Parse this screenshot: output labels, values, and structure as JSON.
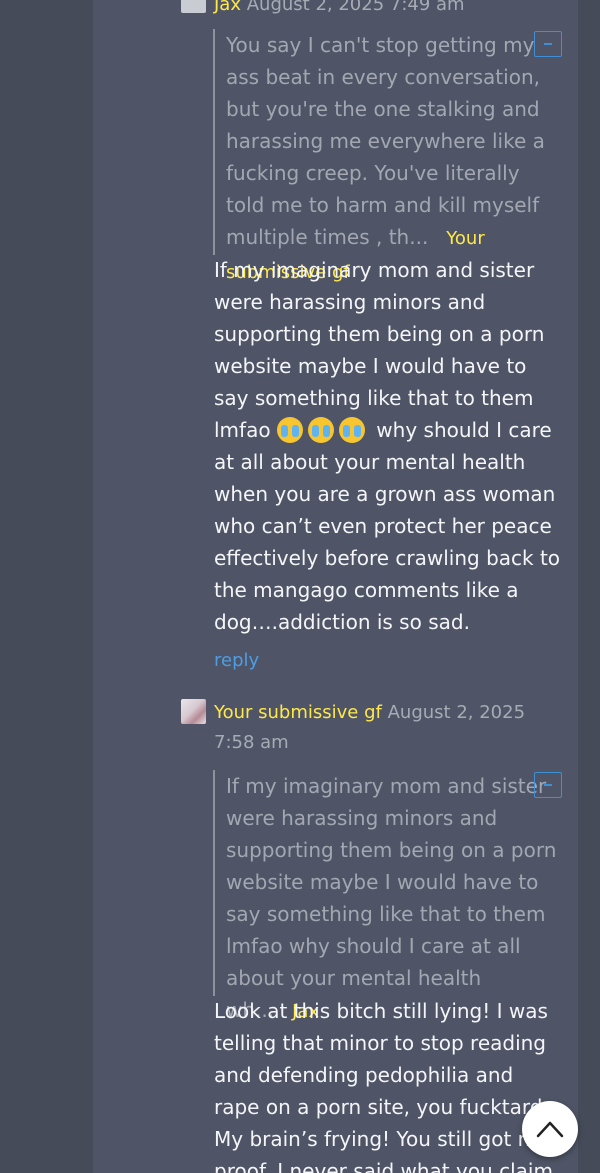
{
  "comments": [
    {
      "author": "Jax",
      "timestamp": "August 2, 2025 7:49 am",
      "quote_text": "You say I can't stop getting my ass beat in every conversation, but you're the one stalking and harassing me everywhere like a fucking creep. You've literally told me to harm and kill myself multiple times , th...",
      "quote_author": "Your submissive gf",
      "text_before_emoji": "If my imaginary mom and sister were harassing minors and supporting them being on a porn website maybe I would have to say something like that to them lmfao",
      "emoji_names": [
        "loudly-crying-face-icon",
        "loudly-crying-face-icon",
        "loudly-crying-face-icon"
      ],
      "text_after_emoji": "why should I care at all about your mental health when you are a grown ass woman who can’t even protect her peace effectively before crawling back to the mangago comments like a dog….addiction is so sad.",
      "reply_label": "reply"
    },
    {
      "author": "Your submissive gf",
      "timestamp": "August 2, 2025 7:58 am",
      "quote_text": "If my imaginary mom and sister were harassing minors and supporting them being on a porn website maybe I would have to say something like that to them lmfao why should I care at all about your mental health wh...",
      "quote_author": "Jax",
      "text": "Look at this bitch still lying! I was telling that minor to stop reading and defending pedophilia and rape on a porn site, you fucktard. My brain’s frying! You still got no proof. I never said what you claim, ‘cause I never"
    }
  ],
  "colors": {
    "page_bg": "#454b58",
    "panel_bg": "#4f5566",
    "author_color": "#ffe84a",
    "link_color": "#4e9de3",
    "quote_text_color": "#a3a7b1",
    "body_text_color": "#f4f5f7"
  },
  "icons": {
    "collapse": "minus-collapse-icon",
    "scroll_top": "chevron-up-icon"
  }
}
